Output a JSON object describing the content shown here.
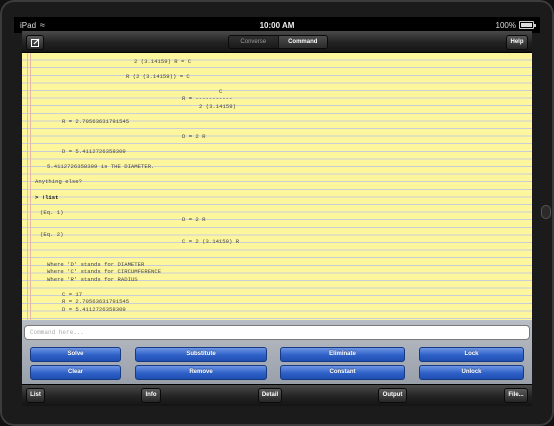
{
  "status_bar": {
    "carrier": "iPad",
    "time": "10:00 AM",
    "battery": "100%"
  },
  "toolbar": {
    "compose_icon": "compose-icon",
    "segments": [
      "Converse",
      "Command"
    ],
    "active_segment": "Command",
    "help_label": "Help"
  },
  "notepad": {
    "lines": [
      "2 (3.14159) R = C",
      "R (2 (3.14159)) = C",
      "C",
      "R = -----------",
      "2 (3.14159)",
      "R = 2.70563631791545",
      "D = 2 R",
      "D = 5.4112726358309",
      "5.4112726358309 is THE DIAMETER.",
      "Anything else?",
      "> !list",
      "(Eq. 1)",
      "D = 2 R",
      "(Eq. 2)",
      "C = 2 (3.14159) R",
      "Where 'D' stands for DIAMETER",
      "Where 'C' stands for CIRCUMFERENCE",
      "Where 'R' stands for RADIUS",
      "C = 17",
      "R = 2.70563631791545",
      "D = 5.4112726358309"
    ]
  },
  "command": {
    "placeholder": "Command here..."
  },
  "ops": {
    "row1": [
      "Solve",
      "Substitute",
      "Eliminate",
      "Lock"
    ],
    "row2": [
      "Clear",
      "Remove",
      "Constant",
      "Unlock"
    ]
  },
  "bottom_bar": {
    "list": "List",
    "info": "Info",
    "detail": "Detail",
    "output": "Output",
    "file": "File..."
  },
  "colors": {
    "accent_blue": "#2e60c6",
    "paper_yellow": "#fdf69d"
  }
}
